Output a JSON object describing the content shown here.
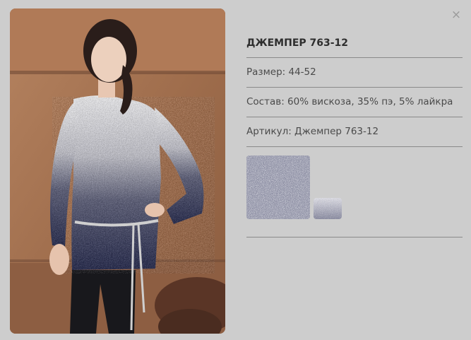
{
  "close": {
    "icon": "close-icon",
    "glyph": "×"
  },
  "product": {
    "title": "ДЖЕМПЕР 763-12",
    "size": "Размер: 44-52",
    "composition": "Состав: 60% вискоза, 35% пэ, 5% лайкра",
    "article": "Артикул: Джемпер 763-12"
  },
  "colors": {
    "background": "#cdcdcd",
    "divider": "#8a8a8a",
    "text": "#4a4a4a"
  }
}
